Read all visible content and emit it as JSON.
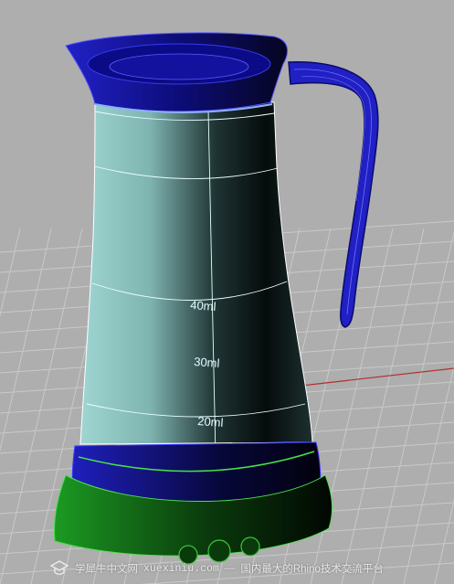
{
  "viewport": {
    "background_color": "#aeaeae",
    "grid_color": "#c9c9c9",
    "axis_color": "#b03030",
    "body_highlight_color": "#8fc7c4",
    "body_shadow_color": "#0a1212",
    "trim_color": "#1a1aa8",
    "base_color": "#18a020",
    "model_labels": {
      "mark_40": "40ml",
      "mark_30": "30ml",
      "mark_20": "20ml"
    }
  },
  "watermark": {
    "icon": "scholar-logo-icon",
    "name": "学犀牛中文网",
    "site": "xuexiniu.com",
    "separator": "—",
    "slogan": "国内最大的Rhino技术交流平台"
  }
}
